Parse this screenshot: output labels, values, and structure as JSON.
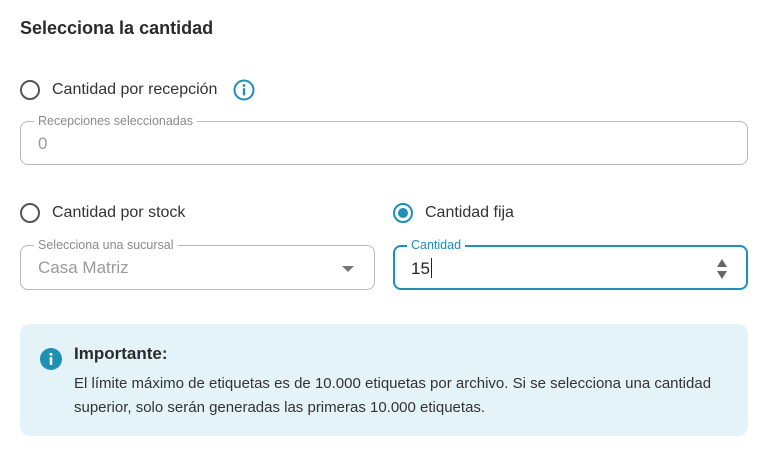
{
  "section_title": "Selecciona la cantidad",
  "colors": {
    "accent": "#1e8fb5",
    "notice_background": "#e3f3f8",
    "border": "#b8b8b8"
  },
  "options": {
    "por_recepcion": {
      "label": "Cantidad por recepción",
      "selected": false,
      "info_icon": "info-circle-icon"
    },
    "por_stock": {
      "label": "Cantidad por stock",
      "selected": false
    },
    "fija": {
      "label": "Cantidad fija",
      "selected": true
    }
  },
  "fields": {
    "recepciones": {
      "label": "Recepciones seleccionadas",
      "value": "0"
    },
    "sucursal": {
      "label": "Selecciona una sucursal",
      "value": "Casa Matriz"
    },
    "cantidad": {
      "label": "Cantidad",
      "value": "15"
    }
  },
  "notice": {
    "icon": "info-filled-icon",
    "title": "Importante:",
    "body": "El límite máximo de etiquetas es de 10.000 etiquetas por archivo. Si se selecciona una cantidad superior, solo serán generadas las primeras 10.000 etiquetas."
  }
}
